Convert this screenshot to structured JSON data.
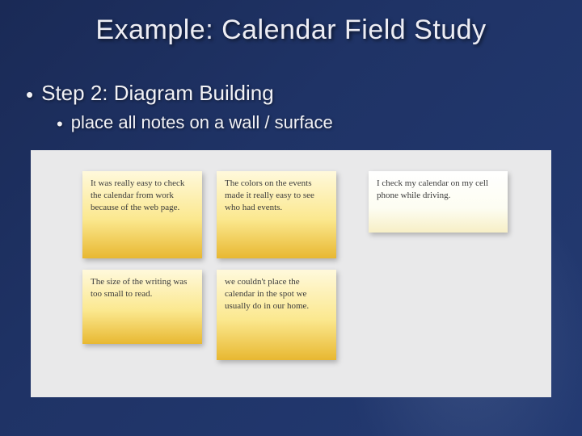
{
  "title": "Example: Calendar Field Study",
  "bullets": {
    "level1": "Step 2: Diagram Building",
    "level2": "place all notes on a wall / surface"
  },
  "notes": {
    "n1": "It was really easy to check the calendar from work because of the web page.",
    "n2": "The colors on the events made it really easy to see who had events.",
    "n3": "I check my calendar on my cell phone while driving.",
    "n4": "The size of the writing was too small to read.",
    "n5": "we couldn't place the calendar in the spot we usually do in our home."
  }
}
